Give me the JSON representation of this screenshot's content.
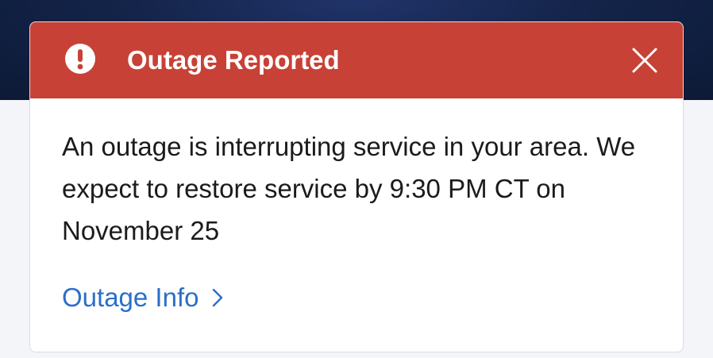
{
  "alert": {
    "title": "Outage Reported",
    "message": "An outage is interrupting service in your area. We expect to restore service by 9:30 PM CT on November 25",
    "link_label": "Outage Info",
    "icons": {
      "status": "exclamation-circle-icon",
      "close": "close-icon",
      "link": "chevron-right-icon"
    },
    "colors": {
      "header_background": "#c84136",
      "link": "#2a6fc9",
      "top_band": "#14244a"
    }
  }
}
